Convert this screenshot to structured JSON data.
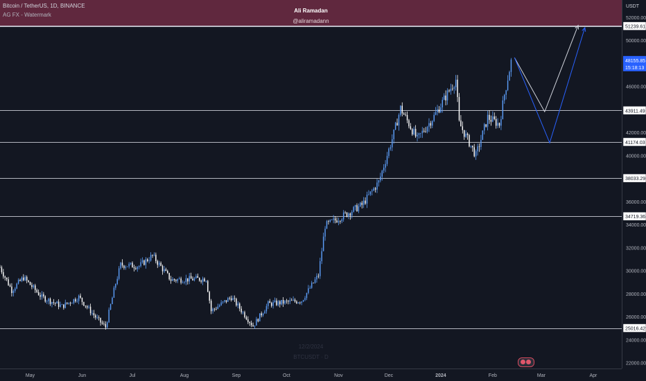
{
  "header": {
    "symbol_title": "Bitcoin / TetherUS, 1D, BINANCE",
    "indicator_label": "AG FX - Watermark",
    "watermark_name": "Ali Ramadan",
    "watermark_handle": "@aliramadann",
    "currency": "USDT"
  },
  "background": {
    "date_text": "12/2/2024",
    "pair_text": "BTCUSDT · D"
  },
  "colors": {
    "background": "#131722",
    "candle_up": "#5b9cf6",
    "candle_down": "#ffffff",
    "level_line": "#d1d4dc",
    "banner": "#6f2c43",
    "projection_white": "#d1d4dc",
    "projection_blue": "#2962ff",
    "current_price": "#2962ff"
  },
  "chart_data": {
    "type": "candlestick",
    "x_axis": {
      "tick_labels": [
        "May",
        "Jun",
        "Jul",
        "Aug",
        "Sep",
        "Oct",
        "Nov",
        "Dec",
        "2024",
        "Feb",
        "Mar",
        "Apr"
      ],
      "tick_dates": [
        "2023-05-01",
        "2023-06-01",
        "2023-07-01",
        "2023-08-01",
        "2023-09-01",
        "2023-10-01",
        "2023-11-01",
        "2023-12-01",
        "2024-01-01",
        "2024-02-01",
        "2024-03-01",
        "2024-04-01"
      ],
      "range": [
        "2023-04-13",
        "2024-04-18"
      ]
    },
    "y_axis": {
      "range": [
        21500,
        53500
      ],
      "tick_labels": [
        "22000.00",
        "24000.00",
        "26000.00",
        "28000.00",
        "30000.00",
        "32000.00",
        "34000.00",
        "36000.00",
        "38000.00",
        "40000.00",
        "42000.00",
        "44000.00",
        "46000.00",
        "48000.00",
        "50000.00",
        "52000.00"
      ],
      "tick_values": [
        22000,
        24000,
        26000,
        28000,
        30000,
        32000,
        34000,
        36000,
        38000,
        40000,
        42000,
        44000,
        46000,
        48000,
        50000,
        52000
      ]
    },
    "price_path": {
      "description_free": true,
      "key_closes": [
        {
          "date": "2023-04-13",
          "value": 30300
        },
        {
          "date": "2023-04-20",
          "value": 28300
        },
        {
          "date": "2023-04-27",
          "value": 29400
        },
        {
          "date": "2023-05-08",
          "value": 27700
        },
        {
          "date": "2023-05-20",
          "value": 26900
        },
        {
          "date": "2023-05-30",
          "value": 27700
        },
        {
          "date": "2023-06-10",
          "value": 25800
        },
        {
          "date": "2023-06-15",
          "value": 25100
        },
        {
          "date": "2023-06-21",
          "value": 28900
        },
        {
          "date": "2023-06-24",
          "value": 30500
        },
        {
          "date": "2023-07-05",
          "value": 30400
        },
        {
          "date": "2023-07-13",
          "value": 31300
        },
        {
          "date": "2023-07-24",
          "value": 29200
        },
        {
          "date": "2023-08-14",
          "value": 29300
        },
        {
          "date": "2023-08-17",
          "value": 26500
        },
        {
          "date": "2023-08-29",
          "value": 27700
        },
        {
          "date": "2023-09-11",
          "value": 25200
        },
        {
          "date": "2023-09-20",
          "value": 27100
        },
        {
          "date": "2023-10-10",
          "value": 27400
        },
        {
          "date": "2023-10-20",
          "value": 29600
        },
        {
          "date": "2023-10-24",
          "value": 33900
        },
        {
          "date": "2023-11-03",
          "value": 34700
        },
        {
          "date": "2023-11-15",
          "value": 35700
        },
        {
          "date": "2023-11-25",
          "value": 37700
        },
        {
          "date": "2023-12-04",
          "value": 41900
        },
        {
          "date": "2023-12-08",
          "value": 44100
        },
        {
          "date": "2023-12-18",
          "value": 41400
        },
        {
          "date": "2023-12-28",
          "value": 43400
        },
        {
          "date": "2024-01-10",
          "value": 46600
        },
        {
          "date": "2024-01-12",
          "value": 42800
        },
        {
          "date": "2024-01-22",
          "value": 40000
        },
        {
          "date": "2024-01-29",
          "value": 43300
        },
        {
          "date": "2024-02-05",
          "value": 42700
        },
        {
          "date": "2024-02-08",
          "value": 45300
        },
        {
          "date": "2024-02-12",
          "value": 48156
        }
      ]
    },
    "horizontal_levels": [
      {
        "value": 51239.61,
        "label": "51239.61"
      },
      {
        "value": 43911.49,
        "label": "43911.49"
      },
      {
        "value": 41174.03,
        "label": "41174.03"
      },
      {
        "value": 38033.29,
        "label": "38033.29"
      },
      {
        "value": 34719.36,
        "label": "34719.36"
      },
      {
        "value": 25016.42,
        "label": "25016.42"
      }
    ],
    "current_price": {
      "value": 48155.85,
      "label": "48155.85",
      "countdown": "15:18:13"
    },
    "projections": [
      {
        "color": "white",
        "points": [
          {
            "date": "2024-02-14",
            "value": 48500
          },
          {
            "date": "2024-03-03",
            "value": 43800
          },
          {
            "date": "2024-03-23",
            "value": 51300
          }
        ]
      },
      {
        "color": "blue",
        "points": [
          {
            "date": "2024-02-14",
            "value": 48500
          },
          {
            "date": "2024-03-06",
            "value": 41100
          },
          {
            "date": "2024-03-27",
            "value": 51100
          }
        ]
      }
    ],
    "banner_price_range": [
      51239.61,
      53500
    ]
  }
}
